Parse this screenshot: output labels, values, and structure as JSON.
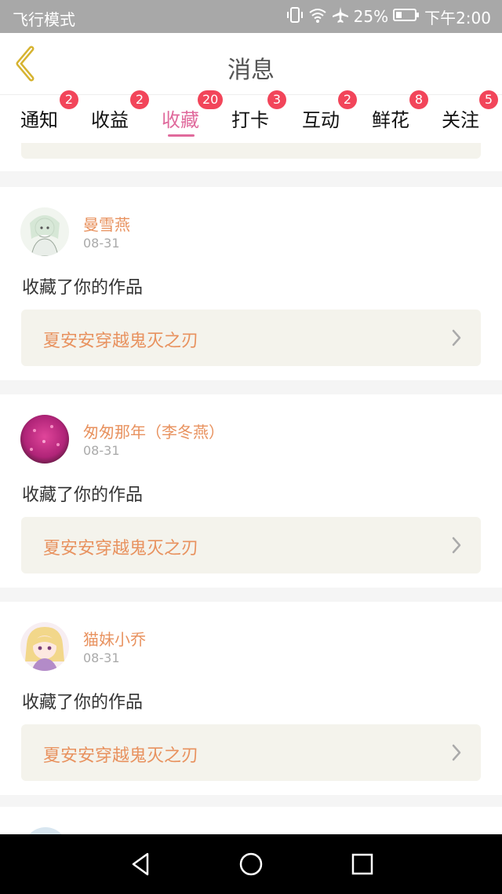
{
  "status_bar": {
    "mode": "飞行模式",
    "battery": "25%",
    "time": "下午2:00",
    "icons": [
      "vibrate-icon",
      "wifi-icon",
      "airplane-icon",
      "battery-icon"
    ]
  },
  "header": {
    "title": "消息",
    "back_icon": "chevron-left-icon"
  },
  "tabs": [
    {
      "label": "通知",
      "badge": "2",
      "active": false
    },
    {
      "label": "收益",
      "badge": "2",
      "active": false
    },
    {
      "label": "收藏",
      "badge": "20",
      "active": true
    },
    {
      "label": "打卡",
      "badge": "3",
      "active": false
    },
    {
      "label": "互动",
      "badge": "2",
      "active": false
    },
    {
      "label": "鲜花",
      "badge": "8",
      "active": false
    },
    {
      "label": "关注",
      "badge": "5",
      "active": false
    }
  ],
  "messages": [
    {
      "user": "曼雪燕",
      "date": "08-31",
      "action": "收藏了你的作品",
      "work": "夏安安穿越鬼灭之刃"
    },
    {
      "user": "匆匆那年（李冬燕）",
      "date": "08-31",
      "action": "收藏了你的作品",
      "work": "夏安安穿越鬼灭之刃"
    },
    {
      "user": "猫妹小乔",
      "date": "08-31",
      "action": "收藏了你的作品",
      "work": "夏安安穿越鬼灭之刃"
    }
  ],
  "colors": {
    "accent": "#e06a9c",
    "username": "#e8925f",
    "badge": "#f2455a",
    "work_bg": "#f4f3ec"
  },
  "nav": [
    "back-triangle-icon",
    "home-circle-icon",
    "recents-square-icon"
  ]
}
